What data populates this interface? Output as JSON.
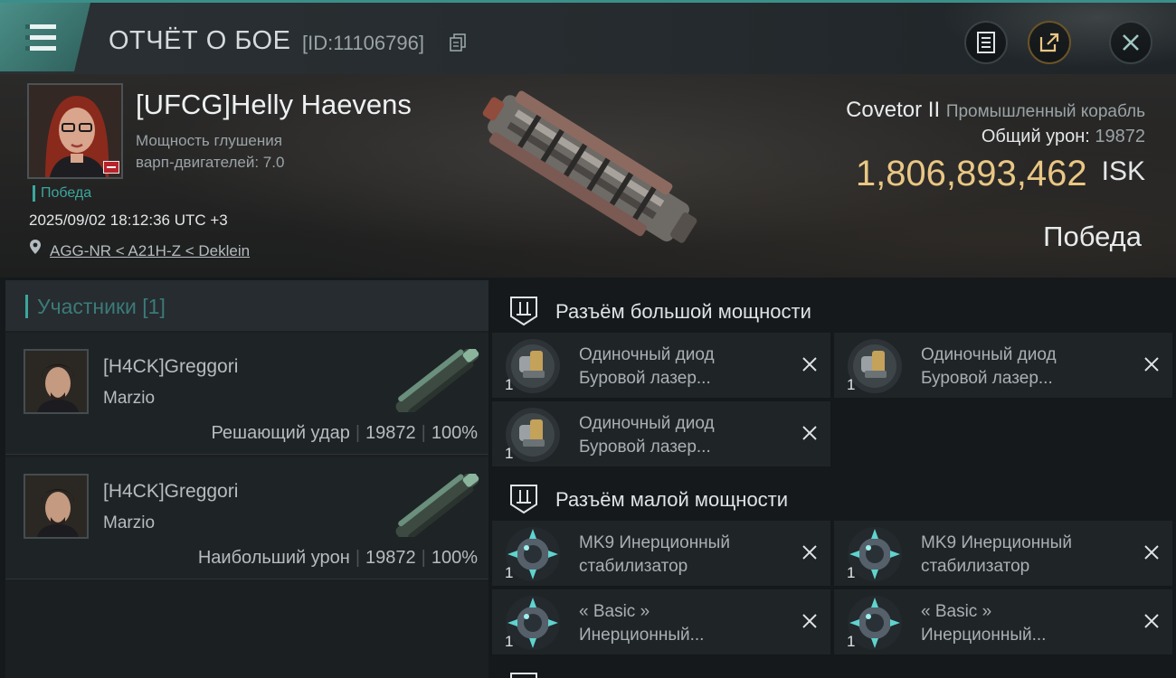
{
  "header": {
    "title": "ОТЧЁТ О БОЕ",
    "id_label": "[ID:11106796]"
  },
  "victim": {
    "name": "[UFCG]Helly Haevens",
    "stat_line1": "Мощность глушения",
    "stat_line2": "варп-двигателей: 7.0",
    "outcome": "Победа",
    "datetime": "2025/09/02 18:12:36 UTC +3",
    "location": "AGG-NR < A21H-Z < Deklein"
  },
  "summary": {
    "ship_name": "Covetor II",
    "ship_class": "Промышленный корабль",
    "damage_label": "Общий урон:",
    "damage_value": "19872",
    "isk_value": "1,806,893,462",
    "isk_currency": "ISK",
    "result": "Победа"
  },
  "participants": {
    "header": "Участники [1]",
    "items": [
      {
        "name": "[H4CK]Greggori",
        "pilot": "Marzio",
        "role": "Решающий удар",
        "damage": "19872",
        "percent": "100%"
      },
      {
        "name": "[H4CK]Greggori",
        "pilot": "Marzio",
        "role": "Наибольший урон",
        "damage": "19872",
        "percent": "100%"
      }
    ]
  },
  "fitting": {
    "high_slot_label": "Разъём большой мощности",
    "low_slot_label": "Разъём малой мощности",
    "high_modules": [
      {
        "line1": "Одиночный диод",
        "line2": "Буровой лазер...",
        "qty": "1"
      },
      {
        "line1": "Одиночный диод",
        "line2": "Буровой лазер...",
        "qty": "1"
      },
      {
        "line1": "Одиночный диод",
        "line2": "Буровой лазер...",
        "qty": "1"
      }
    ],
    "low_modules": [
      {
        "line1": "MK9 Инерционный",
        "line2": "стабилизатор",
        "qty": "1"
      },
      {
        "line1": "MK9 Инерционный",
        "line2": "стабилизатор",
        "qty": "1"
      },
      {
        "line1": "« Basic »",
        "line2": "Инерционный...",
        "qty": "1"
      },
      {
        "line1": "« Basic »",
        "line2": "Инерционный...",
        "qty": "1"
      }
    ]
  },
  "colors": {
    "accent": "#3ba79e",
    "isk": "#e9c784"
  }
}
